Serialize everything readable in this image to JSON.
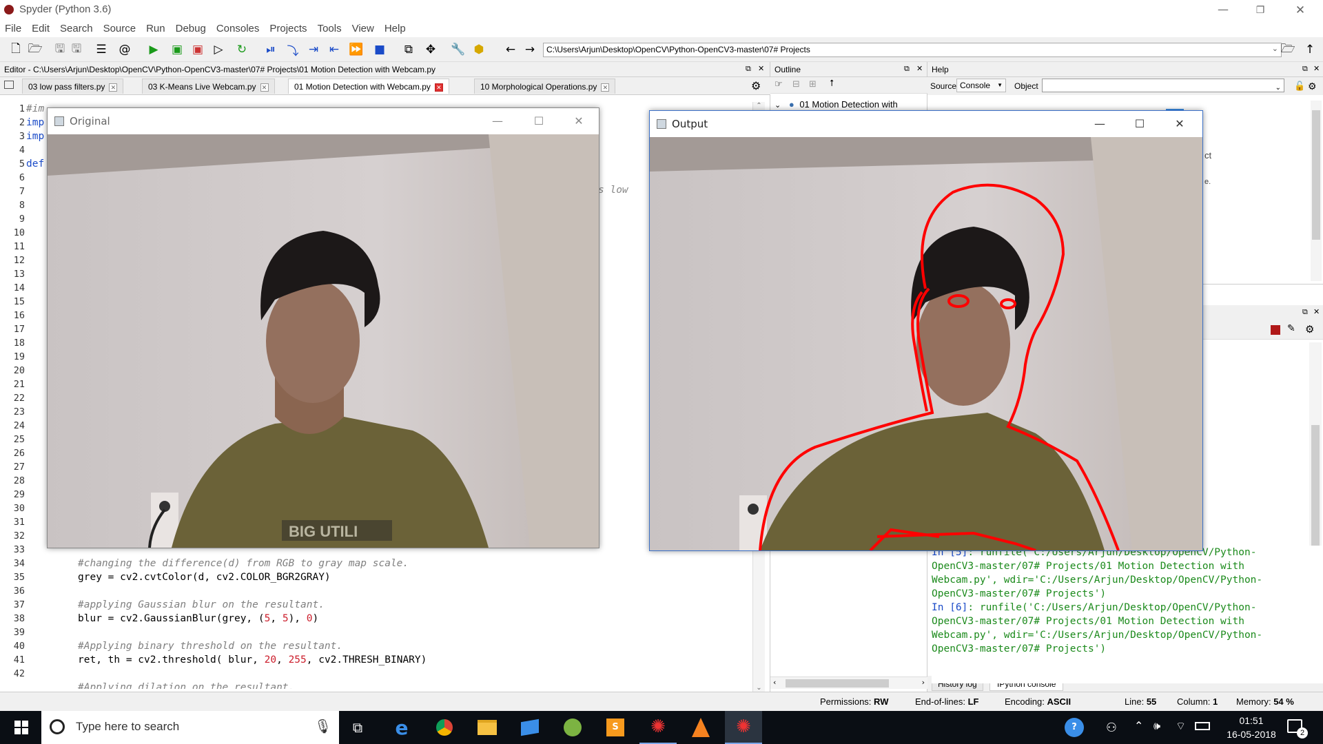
{
  "window": {
    "title": "Spyder (Python 3.6)"
  },
  "menu": [
    "File",
    "Edit",
    "Search",
    "Source",
    "Run",
    "Debug",
    "Consoles",
    "Projects",
    "Tools",
    "View",
    "Help"
  ],
  "toolbar": {
    "path": "C:\\Users\\Arjun\\Desktop\\OpenCV\\Python-OpenCV3-master\\07# Projects"
  },
  "editor": {
    "title": "Editor - C:\\Users\\Arjun\\Desktop\\OpenCV\\Python-OpenCV3-master\\07# Projects\\01 Motion Detection with Webcam.py",
    "tabs": [
      "03 low pass filters.py",
      "03 K-Means Live Webcam.py",
      "01 Motion Detection with Webcam.py",
      "10 Morphological Operations.py"
    ],
    "active_tab": 2,
    "line_numbers": [
      "1",
      "2",
      "3",
      "4",
      "5",
      "6",
      "7",
      "8",
      "9",
      "10",
      "11",
      "12",
      "13",
      "14",
      "15",
      "16",
      "17",
      "18",
      "19",
      "20",
      "21",
      "22",
      "23",
      "24",
      "25",
      "26",
      "27",
      "28",
      "29",
      "30",
      "31",
      "32",
      "33",
      "34",
      "35",
      "36",
      "37",
      "38",
      "39",
      "40",
      "41",
      "42"
    ],
    "partial_top": [
      "#im",
      "imp",
      "imp",
      "def"
    ],
    "partial_right": "s low",
    "code_34": "#changing the difference(d) from RGB to gray map scale.",
    "code_35a": "grey = cv2.cvtColor(d, cv2.COLOR_BGR2GRAY)",
    "code_37": "#applying Gaussian blur on the resultant.",
    "code_38a": "blur = cv2.GaussianBlur(grey, (",
    "code_38b": "5",
    "code_38c": ", ",
    "code_38d": "5",
    "code_38e": "), ",
    "code_38f": "0",
    "code_38g": ")",
    "code_40": "#Applying binary threshold on the resultant.",
    "code_41a": "ret, th = cv2.threshold( blur, ",
    "code_41b": "20",
    "code_41c": ", ",
    "code_41d": "255",
    "code_41e": ", cv2.THRESH_BINARY)",
    "code_43": "#Applying dilation on the resultant."
  },
  "outline": {
    "title": "Outline",
    "item": "01 Motion Detection with"
  },
  "help": {
    "title": "Help",
    "source_label": "Source",
    "source_value": "Console",
    "object_label": "Object",
    "partial_ct": "ct",
    "partial_e": "e."
  },
  "console": {
    "lines": [
      {
        "prompt": "In [5]",
        "text": ": runfile('C:/Users/Arjun/Desktop/OpenCV/Python-"
      },
      {
        "prompt": "",
        "text": "OpenCV3-master/07# Projects/01 Motion Detection with"
      },
      {
        "prompt": "",
        "text": "Webcam.py', wdir='C:/Users/Arjun/Desktop/OpenCV/Python-"
      },
      {
        "prompt": "",
        "text": "OpenCV3-master/07# Projects')"
      },
      {
        "prompt": "",
        "text": ""
      },
      {
        "prompt": "In [6]",
        "text": ": runfile('C:/Users/Arjun/Desktop/OpenCV/Python-"
      },
      {
        "prompt": "",
        "text": "OpenCV3-master/07# Projects/01 Motion Detection with"
      },
      {
        "prompt": "",
        "text": "Webcam.py', wdir='C:/Users/Arjun/Desktop/OpenCV/Python-"
      },
      {
        "prompt": "",
        "text": "OpenCV3-master/07# Projects')"
      }
    ],
    "tabs": [
      "History log",
      "IPython console"
    ]
  },
  "cv_windows": {
    "original": "Original",
    "output": "Output",
    "shirt_text": "BIG UTILI"
  },
  "status": {
    "permissions_label": "Permissions:",
    "permissions": "RW",
    "eol_label": "End-of-lines:",
    "eol": "LF",
    "encoding_label": "Encoding:",
    "encoding": "ASCII",
    "line_label": "Line:",
    "line": "55",
    "column_label": "Column:",
    "column": "1",
    "memory_label": "Memory:",
    "memory": "54 %"
  },
  "taskbar": {
    "search_placeholder": "Type here to search",
    "time": "01:51",
    "date": "16-05-2018",
    "notif_count": "2"
  },
  "colors": {
    "accent": "#1a4bc8",
    "contour": "#ff0000",
    "taskbar": "#0a0e14"
  }
}
